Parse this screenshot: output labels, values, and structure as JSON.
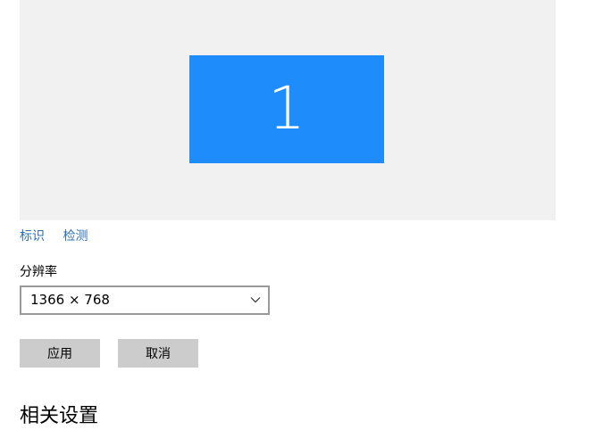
{
  "display": {
    "monitor_number": "1",
    "monitor_color": "#1f8cfb",
    "background_color": "#f2f1f2"
  },
  "links": {
    "identify": "标识",
    "detect": "检测"
  },
  "resolution": {
    "label": "分辨率",
    "value": "1366 × 768",
    "dropdown_icon": "chevron-down-icon"
  },
  "buttons": {
    "apply": "应用",
    "cancel": "取消"
  },
  "related_settings": {
    "heading": "相关设置"
  }
}
